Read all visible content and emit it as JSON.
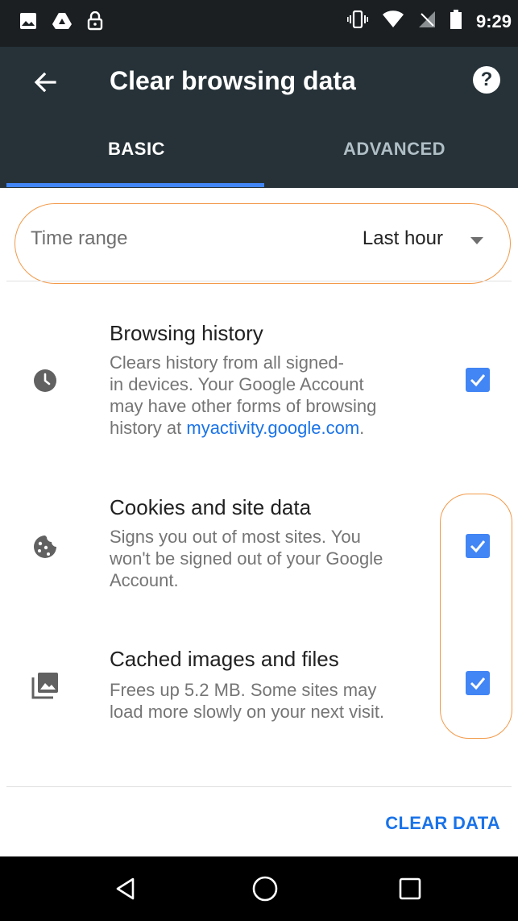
{
  "status_bar": {
    "time": "9:29",
    "left_icons": [
      "image-icon",
      "drive-icon",
      "lock-icon"
    ],
    "right_icons": [
      "vibrate-icon",
      "wifi-icon",
      "no-signal-icon",
      "battery-icon"
    ]
  },
  "app_bar": {
    "title": "Clear browsing data",
    "back_icon": "arrow-back-icon",
    "help_label": "?",
    "bg_color": "#263238"
  },
  "tabs": [
    {
      "label": "BASIC",
      "selected": true
    },
    {
      "label": "ADVANCED",
      "selected": false
    }
  ],
  "time_range": {
    "label": "Time range",
    "value": "Last hour"
  },
  "items": [
    {
      "icon": "clock-icon",
      "title": "Browsing history",
      "desc_lines": [
        "Clears history from all signed-",
        "in devices. Your Google Account",
        "may have other forms of browsing"
      ],
      "desc_prefix": "history at ",
      "desc_link": "myactivity.google.com",
      "desc_suffix": ".",
      "checked": true
    },
    {
      "icon": "cookie-icon",
      "title": "Cookies and site data",
      "desc_lines": [
        "Signs you out of most sites. You",
        "won't be signed out of your Google",
        "Account."
      ],
      "checked": true
    },
    {
      "icon": "images-icon",
      "title": "Cached images and files",
      "desc_lines": [
        "Frees up 5.2 MB. Some sites may",
        "load more slowly on your next visit."
      ],
      "checked": true
    }
  ],
  "clear_button": "CLEAR DATA",
  "colors": {
    "accent": "#4285f4",
    "link": "#1a73e8",
    "highlight_outline": "#f29a4a"
  },
  "nav_bar": {
    "buttons": [
      "back-triangle-icon",
      "home-circle-icon",
      "recents-square-icon"
    ]
  }
}
